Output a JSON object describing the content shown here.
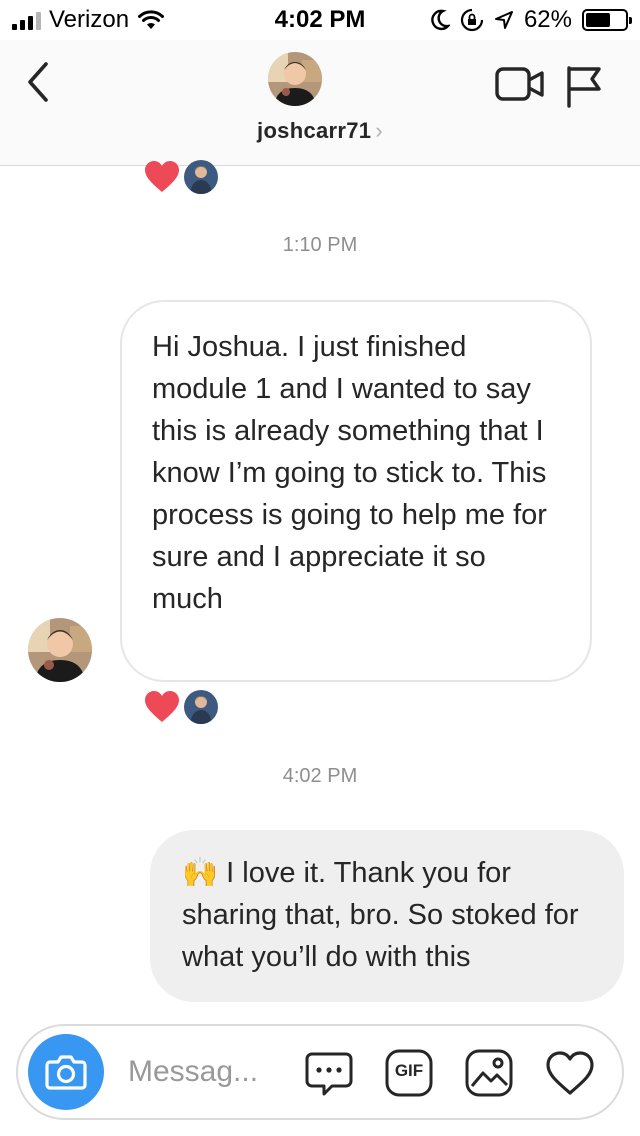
{
  "status_bar": {
    "carrier": "Verizon",
    "time": "4:02 PM",
    "battery_percent": "62%",
    "battery_level": 0.62,
    "icons": [
      "signal-icon",
      "wifi-icon",
      "moon-icon",
      "rotation-lock-icon",
      "location-icon",
      "battery-icon"
    ]
  },
  "header": {
    "username": "joshcarr71",
    "chevron": "›",
    "icons": [
      "back-icon",
      "video-call-icon",
      "flag-icon"
    ]
  },
  "conversation": {
    "timestamps": [
      "1:10 PM",
      "4:02 PM"
    ],
    "incoming_message": "Hi Joshua. I just finished module 1 and I wanted to say this is already something that I know I’m going to stick to. This process is going to help me for sure and I appreciate it so much",
    "outgoing_message": "🙌 I love it. Thank you for sharing that, bro. So stoked for what you’ll do with this",
    "reaction": "heart-icon",
    "colors": {
      "heart": "#ed4956",
      "bubble_out": "#efefef",
      "bubble_in_border": "#e6e6e6"
    }
  },
  "composer": {
    "placeholder": "Messag...",
    "gif_label": "GIF",
    "icons": [
      "camera-icon",
      "chat-bubble-icon",
      "gif-icon",
      "gallery-icon",
      "heart-icon"
    ],
    "colors": {
      "camera": "#3897f0"
    }
  }
}
